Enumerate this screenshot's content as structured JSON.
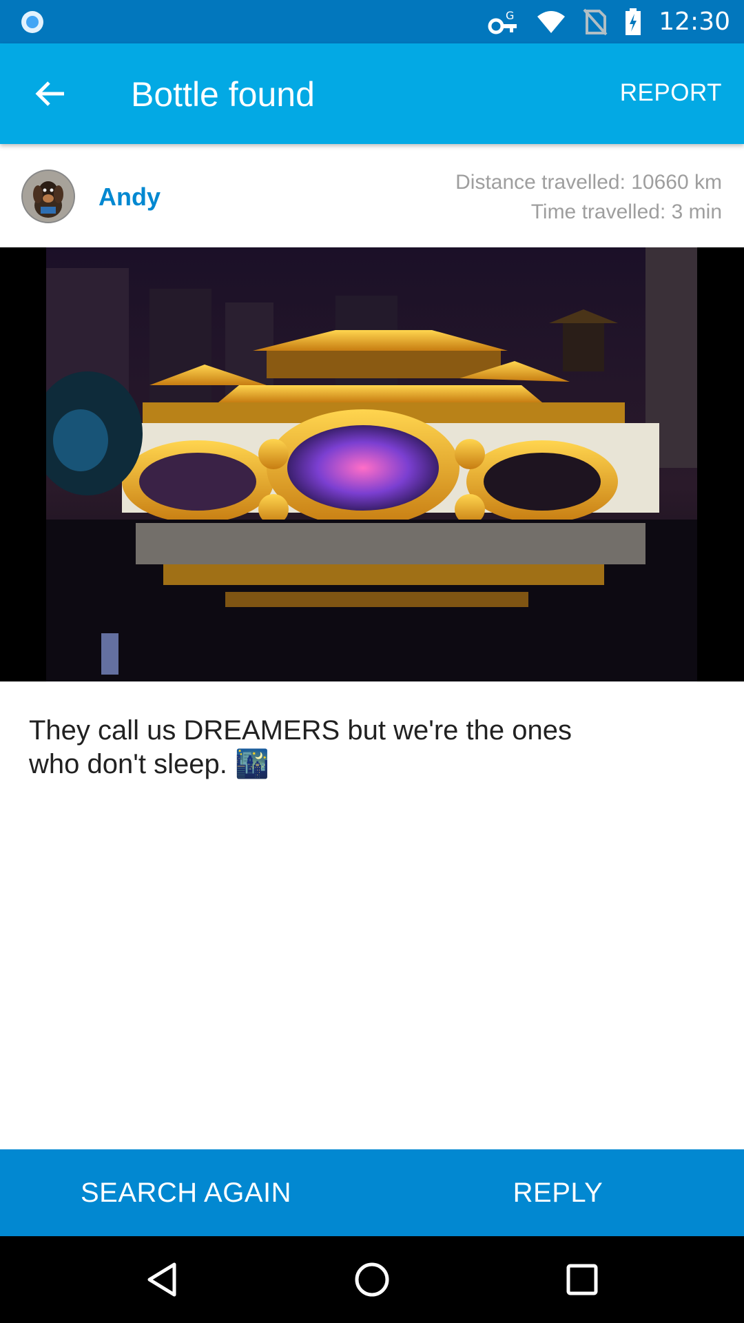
{
  "status_bar": {
    "time": "12:30",
    "icons": [
      "notification-dot-icon",
      "vpn-key-icon",
      "wifi-icon",
      "no-sim-icon",
      "battery-charging-icon"
    ]
  },
  "app_bar": {
    "back_icon": "arrow-back-icon",
    "title": "Bottle found",
    "report_label": "REPORT"
  },
  "sender": {
    "name": "Andy",
    "distance": "Distance travelled: 10660 km",
    "time": "Time travelled: 3 min"
  },
  "message": {
    "text": "They call us DREAMERS but we're the ones who don't sleep. 🌃"
  },
  "actions": {
    "search_again_label": "SEARCH AGAIN",
    "reply_label": "REPLY"
  },
  "nav_bar": {
    "icons": [
      "nav-back-icon",
      "nav-home-icon",
      "nav-recents-icon"
    ]
  },
  "colors": {
    "status_bar": "#0277bd",
    "app_bar": "#03a9e4",
    "action_bar": "#0288d1",
    "sender_name": "#0288d1"
  }
}
